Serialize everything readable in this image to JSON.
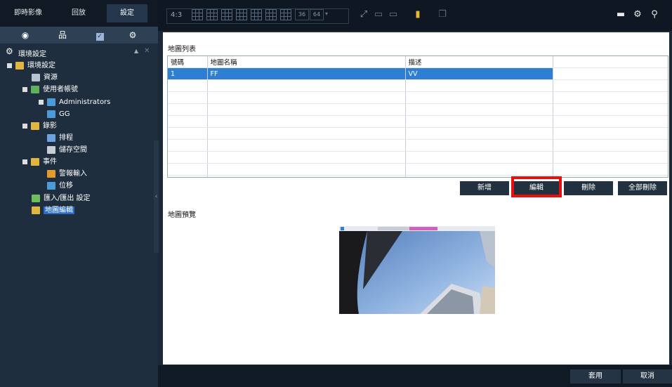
{
  "top_tabs": {
    "live": "即時影像",
    "playback": "回放",
    "settings": "設定"
  },
  "left_toolbar_icons": [
    "eye-icon",
    "network-icon",
    "checklist-icon",
    "gear-icon"
  ],
  "tree": {
    "header": "環境設定",
    "items": [
      {
        "label": "環境設定",
        "level": 0,
        "icon": "folder-settings-icon"
      },
      {
        "label": "資源",
        "level": 1,
        "icon": "resource-icon"
      },
      {
        "label": "使用者帳號",
        "level": 1,
        "icon": "users-icon"
      },
      {
        "label": "Administrators",
        "level": 2,
        "icon": "user-group-icon"
      },
      {
        "label": "GG",
        "level": 3,
        "icon": "user-icon"
      },
      {
        "label": "錄影",
        "level": 1,
        "icon": "record-icon"
      },
      {
        "label": "排程",
        "level": 2,
        "icon": "schedule-icon"
      },
      {
        "label": "儲存空間",
        "level": 2,
        "icon": "storage-icon"
      },
      {
        "label": "事件",
        "level": 1,
        "icon": "event-icon"
      },
      {
        "label": "警報輸入",
        "level": 2,
        "icon": "alarm-input-icon"
      },
      {
        "label": "位移",
        "level": 2,
        "icon": "motion-icon"
      },
      {
        "label": "匯入/匯出 設定",
        "level": 1,
        "icon": "import-export-icon"
      },
      {
        "label": "地圖編輯",
        "level": 1,
        "icon": "map-edit-icon",
        "selected": true
      }
    ]
  },
  "toolbar": {
    "ratio": "4:3",
    "layout36": "36",
    "layout64": "64"
  },
  "content": {
    "map_list_title": "地圖列表",
    "columns": [
      "號碼",
      "地圖名稱",
      "描述"
    ],
    "rows": [
      {
        "no": "1",
        "name": "FF",
        "desc": "VV"
      }
    ],
    "buttons": {
      "add": "新增",
      "edit": "編輯",
      "delete": "刪除",
      "delete_all": "全部刪除"
    },
    "preview_title": "地圖預覽"
  },
  "bottom": {
    "apply": "套用",
    "cancel": "取消"
  },
  "colors": {
    "accent": "#2d7fd4",
    "highlight": "#e51010",
    "panel": "#1f2e3e"
  }
}
